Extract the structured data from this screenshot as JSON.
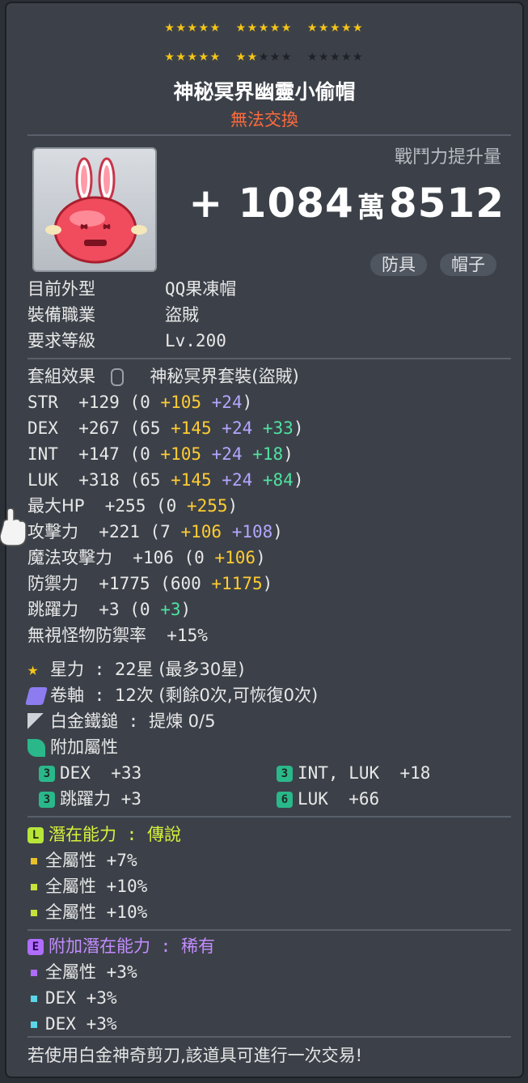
{
  "stars": {
    "row1": [
      "★★★★★",
      "★★★★★",
      "★★★★★"
    ],
    "row2_on": [
      "★★★★★",
      "★★"
    ],
    "row2_off": [
      "★★★",
      "★★★★★"
    ],
    "starforce_count": 22,
    "starforce_max": 30
  },
  "item": {
    "name": "神秘冥界幽靈小偷帽",
    "trade_status": "無法交換",
    "icon": "pink-jelly-bunny-hat-icon",
    "combat_power_label": "戰鬥力提升量",
    "combat_power": {
      "prefix": "+ 1084",
      "unit": "萬",
      "suffix": "8512"
    },
    "tags": [
      "防具",
      "帽子"
    ]
  },
  "info": [
    {
      "label": "目前外型",
      "value": "QQ果凍帽"
    },
    {
      "label": "裝備職業",
      "value": "盜賊"
    },
    {
      "label": "要求等級",
      "value": "Lv.200"
    }
  ],
  "set": {
    "label": "套組效果",
    "value": "神秘冥界套裝(盜賊)"
  },
  "stats": {
    "str": {
      "name": "STR",
      "total": "+129",
      "base": "(0",
      "a": "+105",
      "b": "+24",
      "close": ")"
    },
    "dex": {
      "name": "DEX",
      "total": "+267",
      "base": "(65",
      "a": "+145",
      "b": "+24",
      "c": "+33",
      "close": ")"
    },
    "int": {
      "name": "INT",
      "total": "+147",
      "base": "(0",
      "a": "+105",
      "b": "+24",
      "c": "+18",
      "close": ")"
    },
    "luk": {
      "name": "LUK",
      "total": "+318",
      "base": "(65",
      "a": "+145",
      "b": "+24",
      "c": "+84",
      "close": ")"
    },
    "hp": {
      "name": "最大HP",
      "total": "+255",
      "base": "(0",
      "a": "+255",
      "close": ")"
    },
    "att": {
      "name": "攻擊力",
      "total": "+221",
      "base": "(7",
      "a": "+106",
      "b": "+108",
      "close": ")"
    },
    "matt": {
      "name": "魔法攻擊力",
      "total": "+106",
      "base": "(0",
      "a": "+106",
      "close": ")"
    },
    "def": {
      "name": "防禦力",
      "total": "+1775",
      "base": "(600",
      "a": "+1175",
      "close": ")"
    },
    "jump": {
      "name": "跳躍力",
      "total": "+3",
      "base": "(0",
      "a": "+3",
      "close": ")"
    },
    "ied": {
      "name": "無視怪物防禦率",
      "total": "+15%"
    }
  },
  "upgrades": {
    "starforce": {
      "label": "星力",
      "sep": ":",
      "value": "22星 (最多30星)"
    },
    "scroll": {
      "label": "卷軸",
      "sep": ":",
      "value": "12次 (剩餘0次,可恢復0次)"
    },
    "hammer": {
      "label": "白金鐵鎚",
      "sep": ":",
      "value": "提煉 0/5"
    }
  },
  "flame": {
    "label": "附加屬性",
    "items": [
      {
        "grade": "3",
        "name": "DEX",
        "value": "+33"
      },
      {
        "grade": "3",
        "name": "INT, LUK",
        "value": "+18"
      },
      {
        "grade": "3",
        "name": "跳躍力",
        "value": "+3"
      },
      {
        "grade": "6",
        "name": "LUK",
        "value": "+66"
      }
    ]
  },
  "potential": {
    "badge": "L",
    "label": "潛在能力",
    "sep": ":",
    "grade": "傳說",
    "lines": [
      {
        "name": "全屬性",
        "value": "+7%"
      },
      {
        "name": "全屬性",
        "value": "+10%"
      },
      {
        "name": "全屬性",
        "value": "+10%"
      }
    ]
  },
  "bonus_potential": {
    "badge": "E",
    "label": "附加潛在能力",
    "sep": ":",
    "grade": "稀有",
    "lines": [
      {
        "name": "全屬性",
        "value": "+3%"
      },
      {
        "name": "DEX",
        "value": "+3%"
      },
      {
        "name": "DEX",
        "value": "+3%"
      }
    ]
  },
  "footer": "若使用白金神奇剪刀,該道具可進行一次交易!",
  "colors": {
    "star_on": "#f5c518",
    "untradable": "#ff6a3c",
    "bonus_yellow": "#ffcc33",
    "bonus_purple": "#b3a6ff",
    "bonus_green": "#4ee3a0",
    "legendary": "#d8f23a",
    "rare": "#c38cff"
  }
}
